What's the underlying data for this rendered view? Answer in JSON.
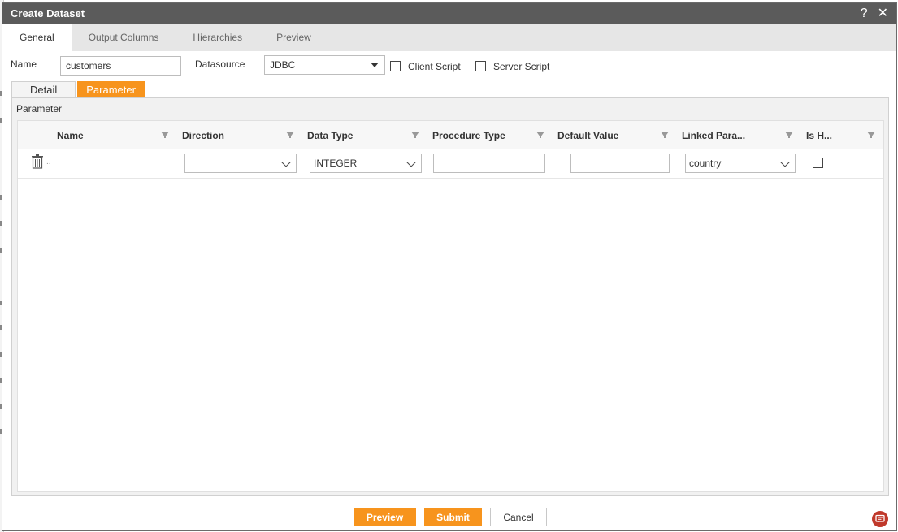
{
  "dialog": {
    "title": "Create Dataset",
    "help_symbol": "?",
    "close_symbol": "✕"
  },
  "tabs": [
    {
      "label": "General",
      "active": true
    },
    {
      "label": "Output Columns",
      "active": false
    },
    {
      "label": "Hierarchies",
      "active": false
    },
    {
      "label": "Preview",
      "active": false
    }
  ],
  "form": {
    "name_label": "Name",
    "name_value": "customers",
    "datasource_label": "Datasource",
    "datasource_value": "JDBC",
    "client_script_label": "Client Script",
    "client_script_checked": false,
    "server_script_label": "Server Script",
    "server_script_checked": false
  },
  "subtabs": [
    {
      "label": "Detail",
      "active": false
    },
    {
      "label": "Parameter",
      "active": true
    }
  ],
  "panel": {
    "title": "Parameter"
  },
  "grid": {
    "columns": [
      "Name",
      "Direction",
      "Data Type",
      "Procedure Type",
      "Default Value",
      "Linked Para...",
      "Is H..."
    ],
    "rows": [
      {
        "name": "",
        "direction": "",
        "data_type": "INTEGER",
        "procedure_type": "",
        "default_value": "",
        "linked_parameter": "country",
        "is_hidden": false
      }
    ]
  },
  "footer": {
    "preview_label": "Preview",
    "submit_label": "Submit",
    "cancel_label": "Cancel"
  },
  "colors": {
    "accent": "#f7941d",
    "titlebar": "#5b5b5b",
    "chat_icon": "#c0392b"
  }
}
